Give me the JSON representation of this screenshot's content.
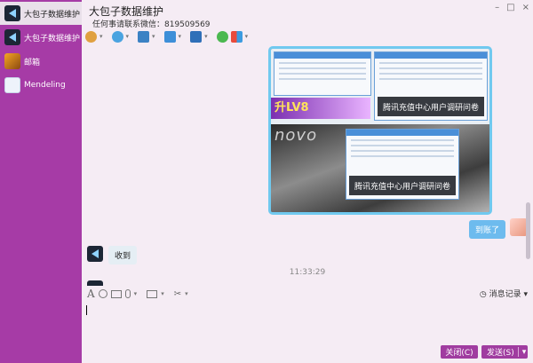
{
  "sidebar": {
    "items": [
      {
        "label": "大包子数据维护",
        "icon": "qq-logo-avatar"
      },
      {
        "label": "大包子数据维护",
        "icon": "qq-logo-avatar"
      },
      {
        "label": "邮箱",
        "icon": "orange-avatar"
      },
      {
        "label": "Mendeling",
        "icon": "user-avatar"
      }
    ]
  },
  "header": {
    "title": "大包子数据维护",
    "subtitle": "任何事请联系微信：819509569",
    "window_controls": [
      "–",
      "□",
      "×"
    ]
  },
  "toolbar": {
    "icons": [
      "microphone-icon",
      "video-icon",
      "screen-share-icon",
      "folder-icon",
      "remote-desktop-icon",
      "add-app-icon",
      "apps-grid-icon"
    ],
    "dropdown_glyph": "▾"
  },
  "chat": {
    "image_texts": {
      "banner": "腾讯充值中心用户调研问卷",
      "novo": "novo",
      "lv8": "升LV8"
    },
    "messages": [
      {
        "side": "right",
        "text": "到账了"
      },
      {
        "side": "left",
        "text": "收到"
      }
    ],
    "timestamp": "11:33:29"
  },
  "input_toolbar": {
    "icons": [
      "font-icon",
      "emoji-icon",
      "gif-icon",
      "voice-icon",
      "image-icon",
      "screenshot-icon"
    ],
    "history_label": "消息记录",
    "history_glyph": "◷"
  },
  "buttons": {
    "close_label": "关闭(C)",
    "send_label": "发送(S)",
    "send_dropdown": "▾"
  },
  "colors": {
    "sidebar_bg": "#a63ba6",
    "accent": "#a03ca0",
    "my_bubble": "#6dbbee"
  }
}
